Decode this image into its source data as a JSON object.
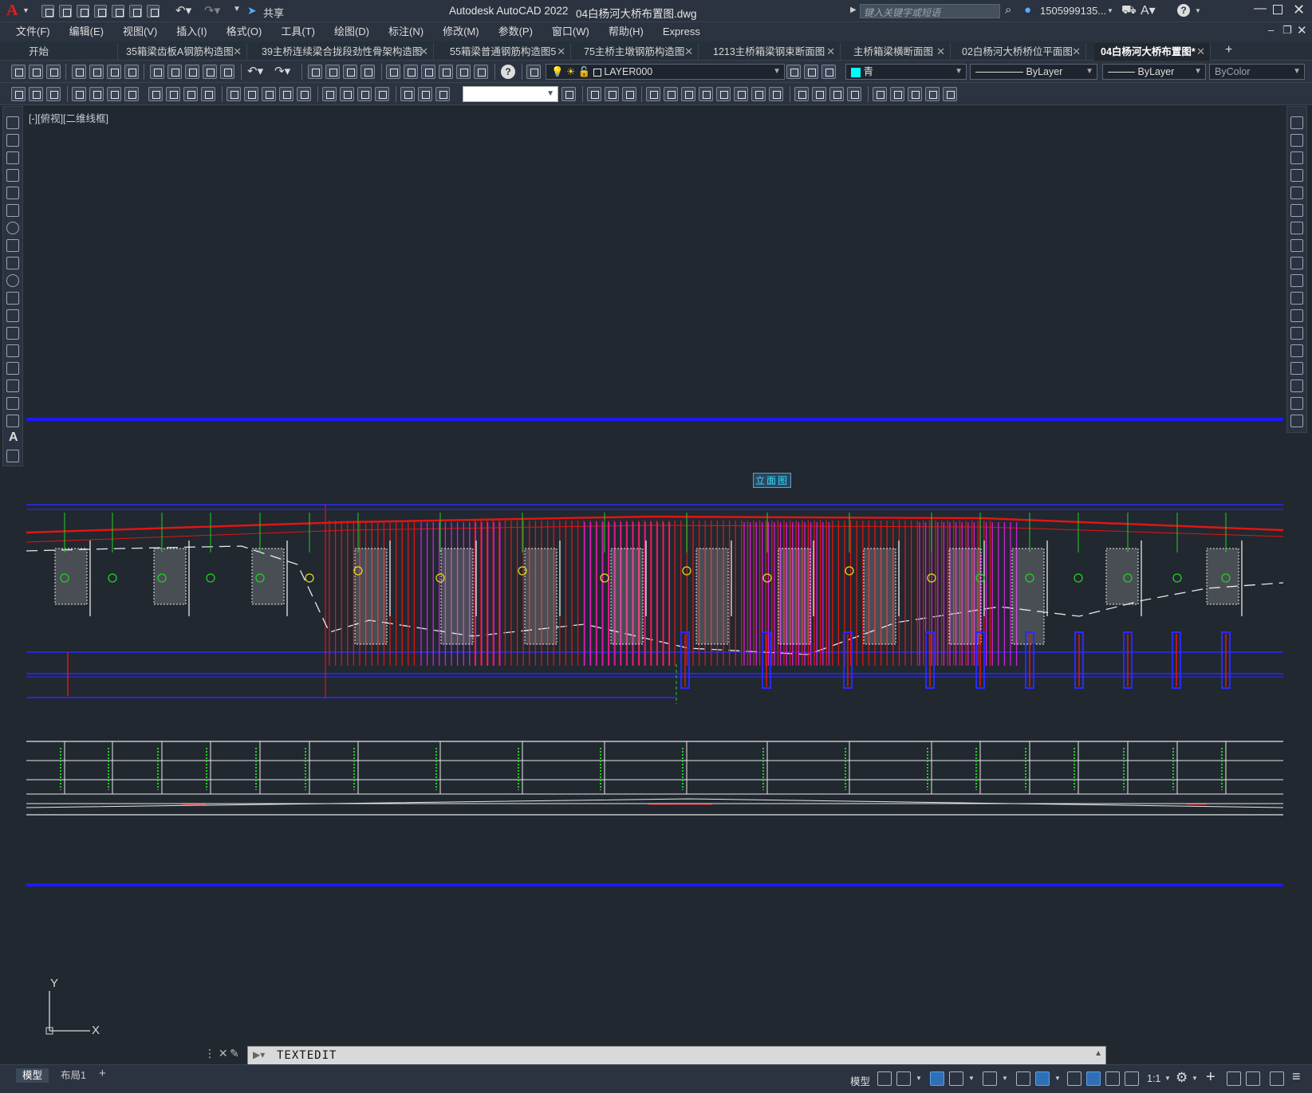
{
  "app": {
    "logo": "A",
    "share_label": "共享",
    "title": "Autodesk AutoCAD 2022",
    "filename": "04白杨河大桥布置图.dwg",
    "search_placeholder": "键入关键字或短语",
    "username": "1505999135...",
    "help": "?"
  },
  "menu": [
    "文件(F)",
    "编辑(E)",
    "视图(V)",
    "插入(I)",
    "格式(O)",
    "工具(T)",
    "绘图(D)",
    "标注(N)",
    "修改(M)",
    "参数(P)",
    "窗口(W)",
    "帮助(H)",
    "Express"
  ],
  "tabs": [
    "开始",
    "35箱梁齿板A钢筋构造图",
    "39主桥连续梁合拢段劲性骨架构造图",
    "55箱梁普通钢筋构造图5",
    "75主桥主墩钢筋构造图",
    "1213主桥箱梁钢束断面图",
    "主桥箱梁横断面图",
    "02白杨河大桥桥位平面图",
    "04白杨河大桥布置图*"
  ],
  "properties": {
    "layer": "LAYER000",
    "color": "青",
    "linetype": "ByLayer",
    "lineweight": "ByLayer",
    "plotstyle": "ByColor"
  },
  "viewport_label": "[-][俯视][二维线框]",
  "drawing": {
    "elevation_title": "立面图",
    "accent_red": "#e01515",
    "accent_magenta": "#d020d8",
    "accent_blue": "#1a1aff",
    "accent_green": "#22d022"
  },
  "ucs": {
    "x": "X",
    "y": "Y"
  },
  "command": {
    "text": "TEXTEDIT"
  },
  "layouts": [
    "模型",
    "布局1"
  ],
  "status": {
    "model": "模型",
    "scale": "1:1"
  }
}
